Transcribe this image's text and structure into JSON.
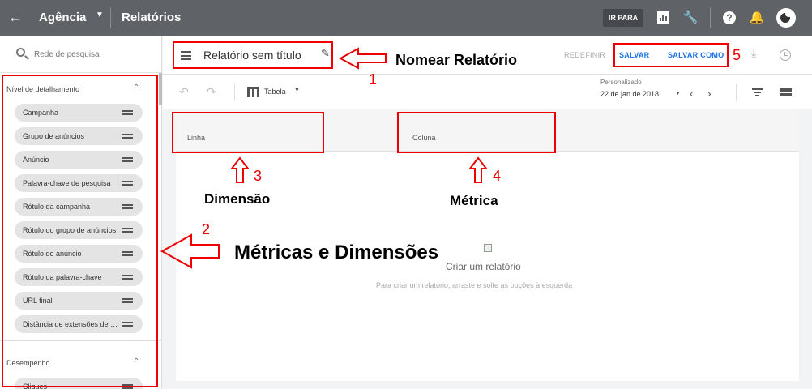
{
  "topbar": {
    "account": "Agência",
    "section": "Relatórios",
    "goto_label": "IR PARA"
  },
  "sidebar": {
    "search_placeholder": "Rede de pesquisa",
    "groups": [
      {
        "title": "Nível de detalhamento",
        "items": [
          "Campanha",
          "Grupo de anúncios",
          "Anúncio",
          "Palavra-chave de pesquisa",
          "Rótulo da campanha",
          "Rótulo do grupo de anúncios",
          "Rótulo do anúncio",
          "Rótulo da palavra-chave",
          "URL final",
          "Distância de extensões de local"
        ]
      },
      {
        "title": "Desempenho",
        "items": [
          "Cliques"
        ]
      }
    ]
  },
  "header": {
    "report_title": "Relatório sem título",
    "reset_label": "REDEFINIR",
    "save_label": "SALVAR",
    "save_as_label": "SALVAR COMO"
  },
  "toolbar": {
    "view_label": "Tabela",
    "date_caption": "Personalizado",
    "date_value": "22 de jan de 2018"
  },
  "canvas": {
    "row_drop": "Linha",
    "column_drop": "Coluna",
    "empty_title": "Criar um relatório",
    "empty_subtitle": "Para criar um relatório, arraste e solte as opções à esquerda"
  },
  "annotations": {
    "n1": "1",
    "n2": "2",
    "n3": "3",
    "n4": "4",
    "n5": "5",
    "label_rename": "Nomear Relatório",
    "label_metrics_dims": "Métricas e Dimensões",
    "label_dimension": "Dimensão",
    "label_metric": "Métrica",
    "color": "#e00000"
  }
}
